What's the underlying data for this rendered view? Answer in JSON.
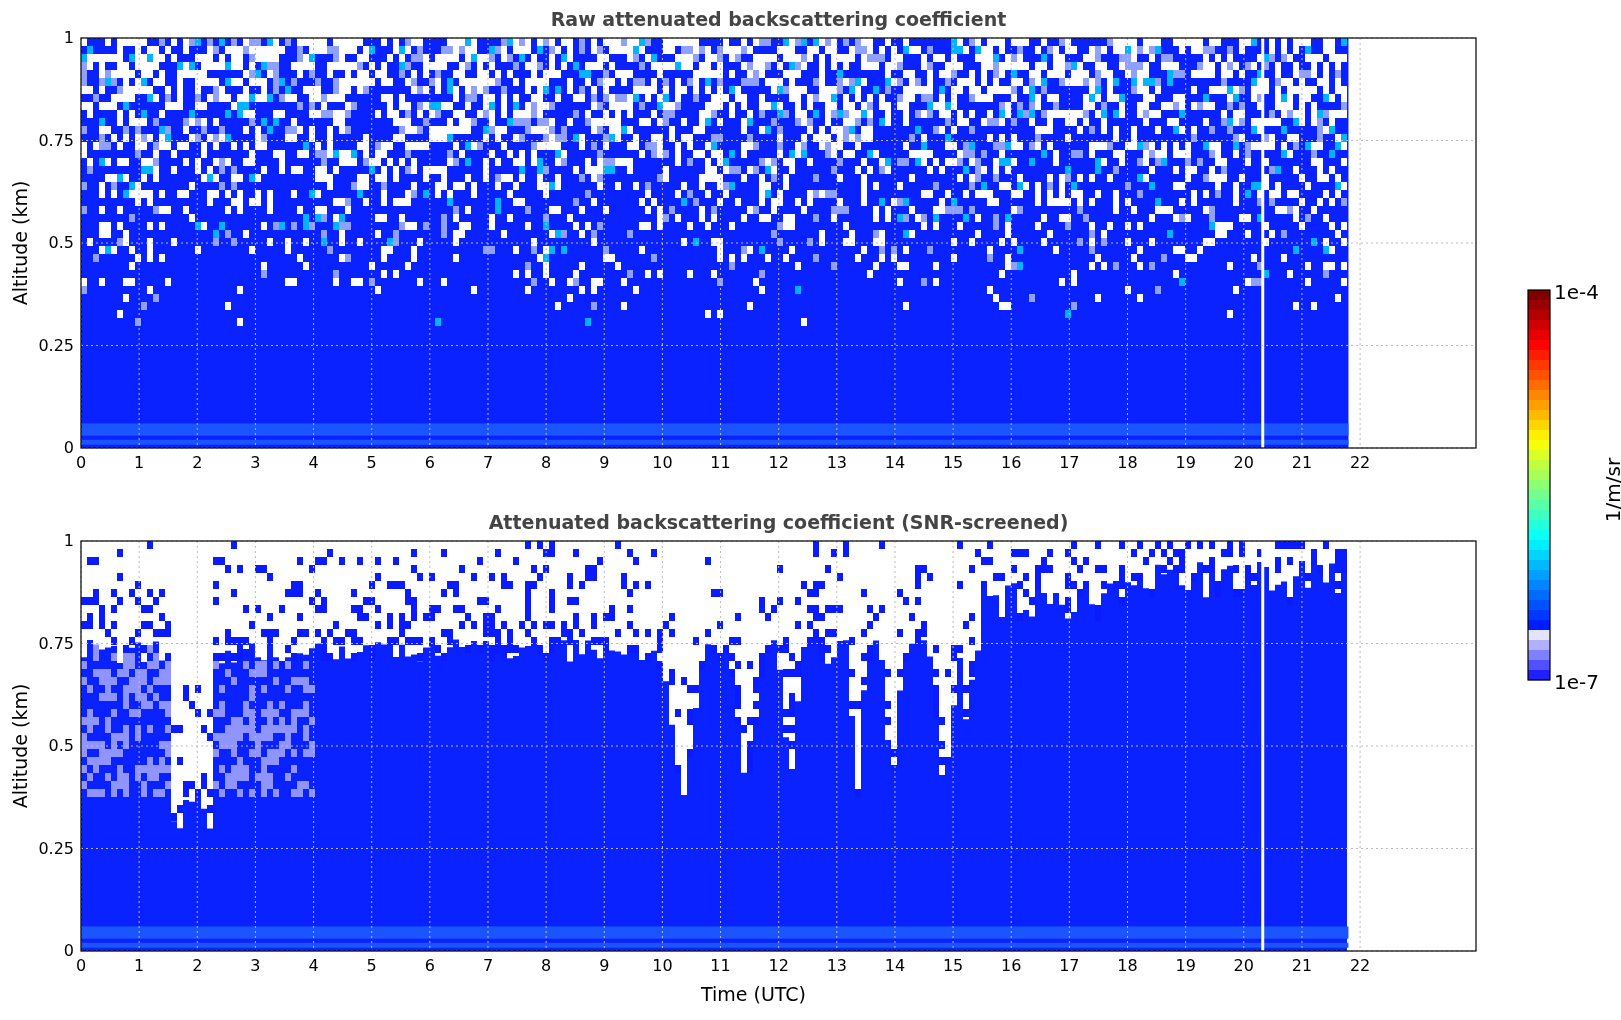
{
  "panels": [
    {
      "kind": "raw",
      "title": "Raw attenuated backscattering coefficient",
      "ylabel": "Altitude (km)",
      "yticks": [
        "1",
        "0.75",
        "0.5",
        "0.25",
        "0"
      ],
      "xticks": [
        "0",
        "1",
        "2",
        "3",
        "4",
        "5",
        "6",
        "7",
        "8",
        "9",
        "10",
        "11",
        "12",
        "13",
        "14",
        "15",
        "16",
        "17",
        "18",
        "19",
        "20",
        "21",
        "22"
      ]
    },
    {
      "kind": "screened",
      "title": "Attenuated backscattering coefficient (SNR-screened)",
      "ylabel": "Altitude (km)",
      "yticks": [
        "1",
        "0.75",
        "0.5",
        "0.25",
        "0"
      ],
      "xticks": [
        "0",
        "1",
        "2",
        "3",
        "4",
        "5",
        "6",
        "7",
        "8",
        "9",
        "10",
        "11",
        "12",
        "13",
        "14",
        "15",
        "16",
        "17",
        "18",
        "19",
        "20",
        "21",
        "22"
      ],
      "xlabel": "Time (UTC)"
    }
  ],
  "colorbar": {
    "label": "1/m/sr",
    "max_label": "1e-4",
    "min_label": "1e-7"
  }
}
